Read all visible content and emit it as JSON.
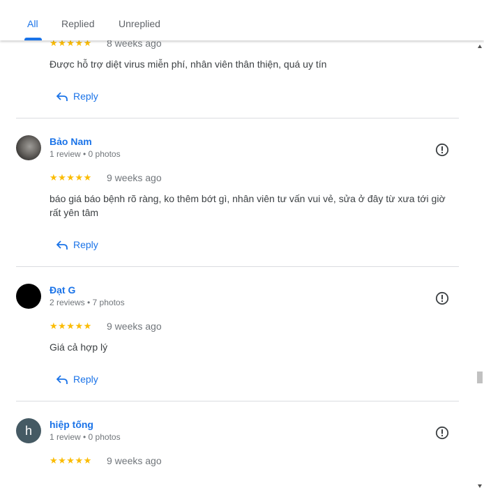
{
  "tabs": [
    {
      "label": "All",
      "active": true
    },
    {
      "label": "Replied",
      "active": false
    },
    {
      "label": "Unreplied",
      "active": false
    }
  ],
  "reviews": [
    {
      "rating": 5,
      "stars": "★★★★★",
      "date": "8 weeks ago",
      "text": "Được hỗ trợ diệt virus miễn phí, nhân viên thân thiện, quá uy tín",
      "reply_label": "Reply"
    },
    {
      "name": "Bảo Nam",
      "meta": "1 review • 0 photos",
      "rating": 5,
      "stars": "★★★★★",
      "date": "9 weeks ago",
      "text": "báo giá báo bệnh rõ ràng, ko thêm bớt gì, nhân viên tư vấn vui vẻ, sửa ở đây từ xưa tới giờ rất yên tâm",
      "reply_label": "Reply"
    },
    {
      "name": "Đạt G",
      "meta": "2 reviews • 7 photos",
      "rating": 5,
      "stars": "★★★★★",
      "date": "9 weeks ago",
      "text": "Giá cả hợp lý",
      "reply_label": "Reply"
    },
    {
      "name": "hiệp tống",
      "meta": "1 review • 0 photos",
      "avatar_letter": "h",
      "rating": 5,
      "stars": "★★★★★",
      "date": "9 weeks ago"
    }
  ],
  "colors": {
    "accent": "#1a73e8",
    "star": "#fbbc04",
    "avatar_h": "#455a64"
  },
  "icons": {
    "reply": "reply-arrow-icon",
    "flag": "report-flag-icon",
    "scroll_up": "scroll-up-arrow-icon",
    "scroll_down": "scroll-down-arrow-icon"
  }
}
